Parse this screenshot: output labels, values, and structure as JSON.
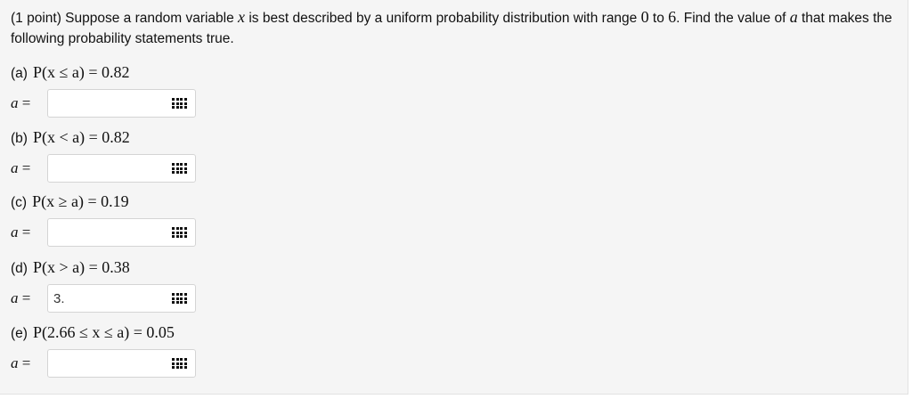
{
  "intro": {
    "part1": "(1 point) Suppose a random variable ",
    "var": "x",
    "part2": " is best described by a uniform probability distribution with range ",
    "low": "0",
    "part3": " to ",
    "high": "6",
    "part4": ". Find the value of ",
    "avar": "a",
    "part5": " that makes the following probability statements true."
  },
  "answer_label": "a =",
  "grid_icon": "palette-grid-icon",
  "parts": [
    {
      "label": "(a)",
      "expr": "P(x ≤ a) = 0.82",
      "value": "",
      "placeholder": ""
    },
    {
      "label": "(b)",
      "expr": "P(x < a) = 0.82",
      "value": "",
      "placeholder": ""
    },
    {
      "label": "(c)",
      "expr": "P(x ≥ a) = 0.19",
      "value": "",
      "placeholder": ""
    },
    {
      "label": "(d)",
      "expr": "P(x > a) = 0.38",
      "value": "3.",
      "placeholder": ""
    },
    {
      "label": "(e)",
      "expr": "P(2.66 ≤ x ≤ a) = 0.05",
      "value": "",
      "placeholder": ""
    }
  ]
}
